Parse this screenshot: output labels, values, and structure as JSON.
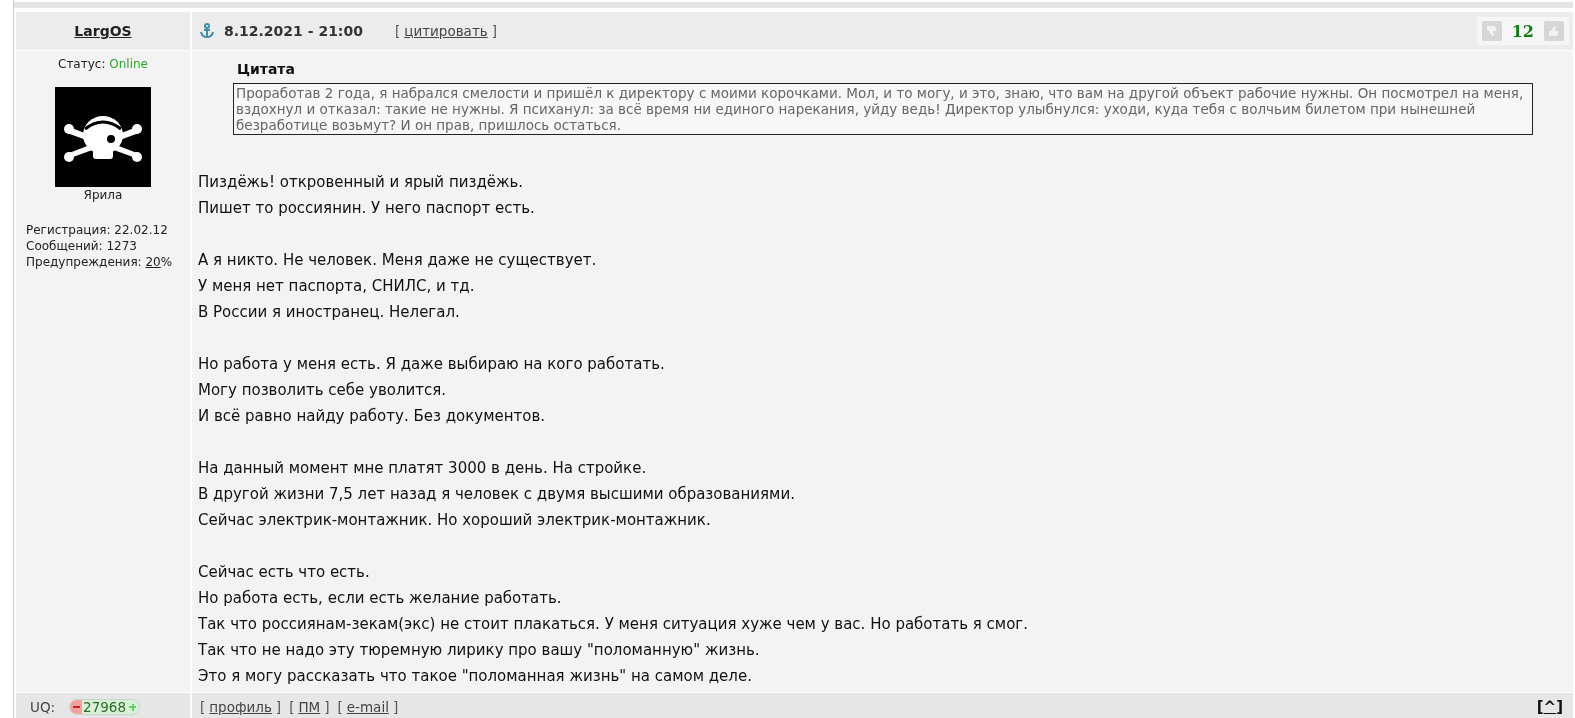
{
  "post": {
    "author": "LargOS",
    "date": "8.12.2021 - 21:00",
    "quote_link": {
      "open": "[",
      "text": "цитировать",
      "close": "]"
    },
    "rating": "12"
  },
  "user": {
    "status_label": "Статус:",
    "status": "Online",
    "online": true,
    "title": "Ярила",
    "stats": [
      {
        "label": "Регистрация:",
        "value": "22.02.12",
        "link": false
      },
      {
        "label": "Сообщений:",
        "value": "1273",
        "link": false
      },
      {
        "label": "Предупреждения:",
        "value": "20",
        "suffix": "%",
        "link": true
      }
    ]
  },
  "quote": {
    "title": "Цитата",
    "text": "Проработав 2 года, я набрался смелости и пришёл к директору с моими корочками. Мол, и то могу, и это, знаю, что вам на другой объект рабочие нужны. Он посмотрел на меня, вздохнул и отказал: такие не нужны. Я психанул: за всё время ни единого нарекания, уйду ведь! Директор улыбнулся: уходи, куда тебя с волчьим билетом при нынешней безработице возьмут? И он прав, пришлось остаться."
  },
  "paragraphs": [
    [
      "Пиздёжь! откровенный и ярый пиздёжь.",
      "Пишет то россиянин. У него паспорт есть."
    ],
    [
      "А я никто. Не человек. Меня даже не существует.",
      "У меня нет паспорта, СНИЛС, и тд.",
      "В России я иностранец. Нелегал."
    ],
    [
      "Но работа у меня есть. Я даже выбираю на кого работать.",
      "Могу позволить себе уволится.",
      "И всё равно найду работу. Без документов."
    ],
    [
      "На данный момент мне платят 3000 в день. На стройке.",
      "В другой жизни 7,5 лет назад я человек с двумя высшими образованиями.",
      "Сейчас электрик-монтажник. Но хороший электрик-монтажник."
    ],
    [
      "Сейчас есть что есть.",
      "Но работа есть, если есть желание работать.",
      "Так что россиянам-зекам(экс) не стоит плакаться. У меня ситуация хуже чем у вас. Но работать я смог.",
      "Так что не надо эту тюремную лирику про вашу \"поломанную\" жизнь.",
      "Это я могу рассказать что такое \"поломанная жизнь\" на самом деле."
    ]
  ],
  "footer": {
    "uq_label": "UQ:",
    "uq_value": "27968",
    "links": [
      {
        "open": "[",
        "text": "профиль",
        "close": "]"
      },
      {
        "open": "[",
        "text": "ПМ",
        "close": "]"
      },
      {
        "open": "[",
        "text": "e-mail",
        "close": "]"
      }
    ],
    "top_link": {
      "open": "[",
      "text": "^",
      "close": "]"
    }
  }
}
